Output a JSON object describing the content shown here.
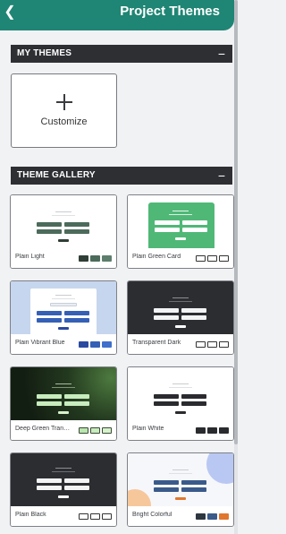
{
  "header": {
    "back_icon": "chevron-left-icon",
    "title": "Project Themes"
  },
  "my_themes": {
    "title": "MY THEMES",
    "collapse_symbol": "−",
    "customize_label": "Customize"
  },
  "gallery": {
    "title": "THEME GALLERY",
    "collapse_symbol": "−",
    "themes": [
      {
        "name": "Plain Light",
        "swatches": [
          "#2f3e36",
          "#4c6b5b",
          "#5d7e6d"
        ]
      },
      {
        "name": "Plain Green Card",
        "swatches": [
          "#ffffff",
          "#ffffff",
          "#ffffff"
        ]
      },
      {
        "name": "Plain Vibrant Blue",
        "swatches": [
          "#2a4aa0",
          "#3560b5",
          "#3f6fcc"
        ]
      },
      {
        "name": "Transparent Dark",
        "swatches": [
          "#ffffff",
          "#ffffff",
          "#ffffff"
        ]
      },
      {
        "name": "Deep Green Transparent",
        "swatches": [
          "#b9e6ae",
          "#c8ecbd",
          "#d6f2cc"
        ]
      },
      {
        "name": "Plain White",
        "swatches": [
          "#2a2b2e",
          "#2a2b2e",
          "#2a2b2e"
        ]
      },
      {
        "name": "Plain Black",
        "swatches": [
          "#ffffff",
          "#ffffff",
          "#ffffff"
        ]
      },
      {
        "name": "Bright Colorful",
        "swatches": [
          "#2e3640",
          "#3a5a8a",
          "#e0772e"
        ]
      }
    ]
  }
}
